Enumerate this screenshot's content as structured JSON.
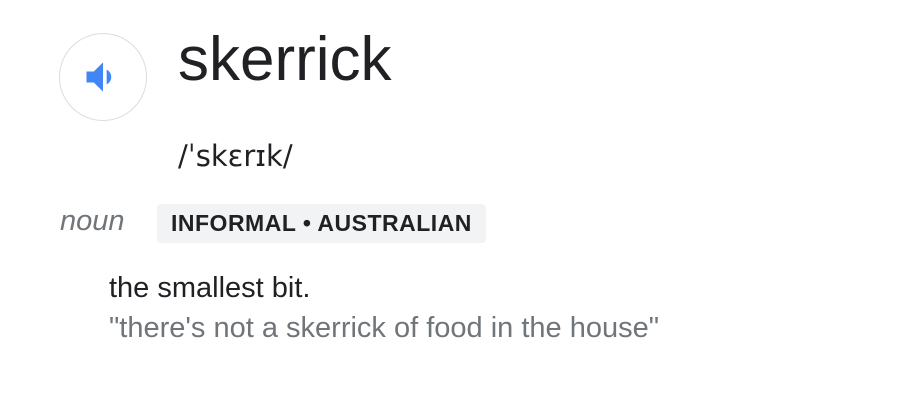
{
  "entry": {
    "audio_icon": "speaker-icon",
    "word": "skerrick",
    "pronunciation": "/ˈskɛrɪk/",
    "part_of_speech": "noun",
    "register": "INFORMAL • AUSTRALIAN",
    "definition": "the smallest bit.",
    "example": "\"there's not a skerrick of food in the house\""
  },
  "colors": {
    "speaker_icon": "#4285f4",
    "speaker_border": "#dadce0",
    "primary_text": "#202124",
    "secondary_text": "#70757a",
    "badge_background": "#f1f3f4"
  }
}
